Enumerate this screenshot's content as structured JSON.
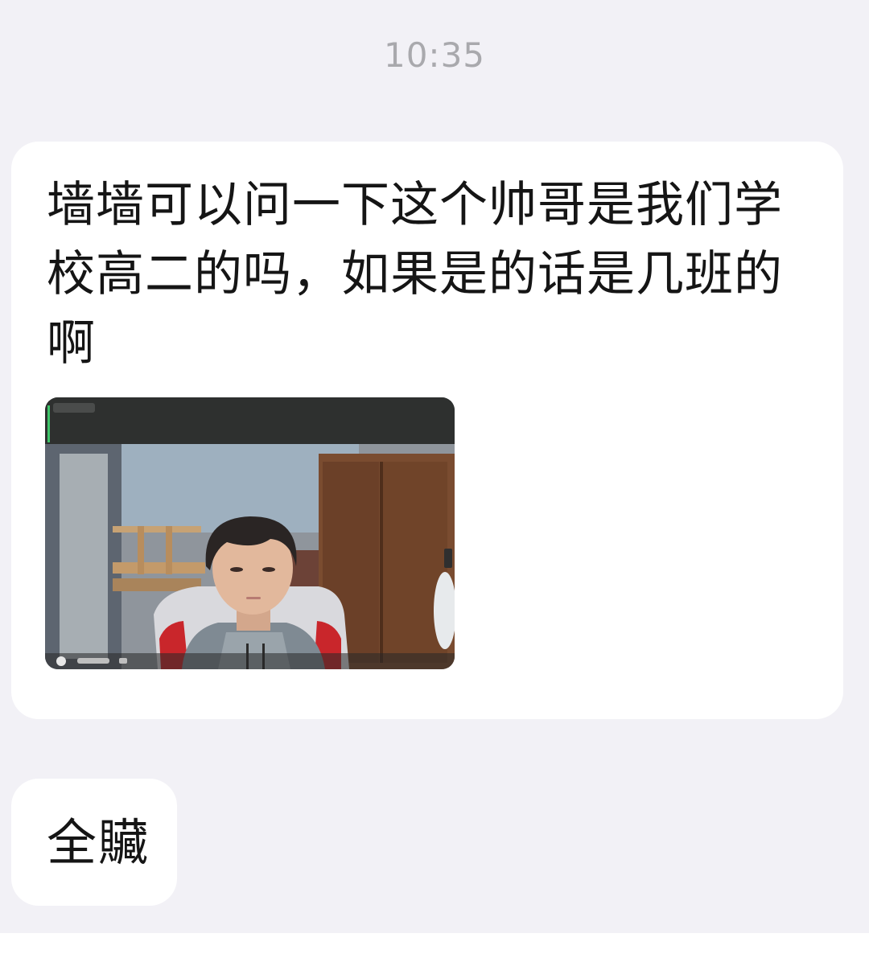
{
  "chat": {
    "timestamp": "10:35",
    "messages": [
      {
        "text": "墙墙可以问一下这个帅哥是我们学校高二的吗，如果是的话是几班的啊",
        "attachment": {
          "type": "photo",
          "subject": "webcam-screenshot"
        }
      },
      {
        "text": "全贜"
      }
    ]
  },
  "colors": {
    "background": "#f2f1f6",
    "bubble": "#ffffff",
    "timestamp": "#a9a9ad",
    "text": "#151515"
  }
}
